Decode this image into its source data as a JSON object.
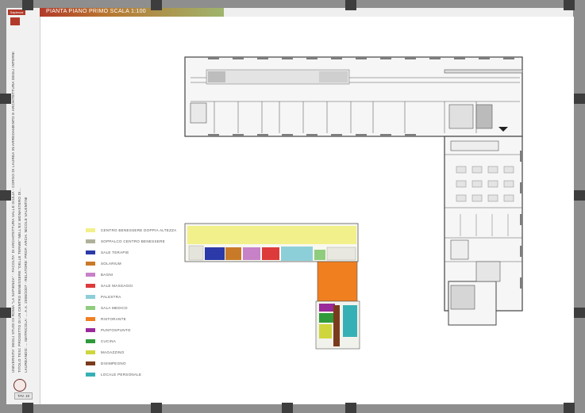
{
  "header": {
    "title": "PIANTA PIANO PRIMO SCALA 1:100",
    "logo_text": "Sapienza"
  },
  "sidebar": {
    "lines": [
      "UNIVERSITA' DEGLI STUDI DI ROMA \"LA SAPIENZA\" - FACOLTA' DI ARCHITETTURA VALLE GIULIA - CORSO DI LAUREA IN ARREDAMENTO E ARCHITETTURA DEGLI INTERNI",
      "TITOLO TESI: PROGETTO DI UN CENTRO BENESSERE \"DELLE TERME\" NELL'EX MONASTERO DI...",
      "LAUREANDO: ... MATRICOLA: ... A.A. 2006/2007 - RELATORE: PROF. ARCH. NICOLE VALENTINI"
    ],
    "tab_label": "TAV. 10"
  },
  "legend": {
    "items": [
      {
        "label": "CENTRO BENESSERE DOPPIA ALTEZZA",
        "color": "#f2f08a"
      },
      {
        "label": "SOPPALCO CENTRO BENESSERE",
        "color": "#b0b19b"
      },
      {
        "label": "SALE TERAPIE",
        "color": "#2b3aa8"
      },
      {
        "label": "SOLARIUM",
        "color": "#c97a28"
      },
      {
        "label": "BAGNI",
        "color": "#c781c7"
      },
      {
        "label": "SALE MASSAGGI",
        "color": "#dd3b3b"
      },
      {
        "label": "PALESTRA",
        "color": "#8dcfd9"
      },
      {
        "label": "SALA MEDICO",
        "color": "#8fcc7d"
      },
      {
        "label": "RISTORANTE",
        "color": "#f07f20"
      },
      {
        "label": "PUNTOSPUNTO",
        "color": "#9a2a99"
      },
      {
        "label": "CUCINA",
        "color": "#2e9a3a"
      },
      {
        "label": "MAGAZZINO",
        "color": "#cfd63d"
      },
      {
        "label": "DISIMPEGNO",
        "color": "#7a3b1d"
      },
      {
        "label": "LOCALE PERSONALE",
        "color": "#36b0b5"
      }
    ]
  }
}
